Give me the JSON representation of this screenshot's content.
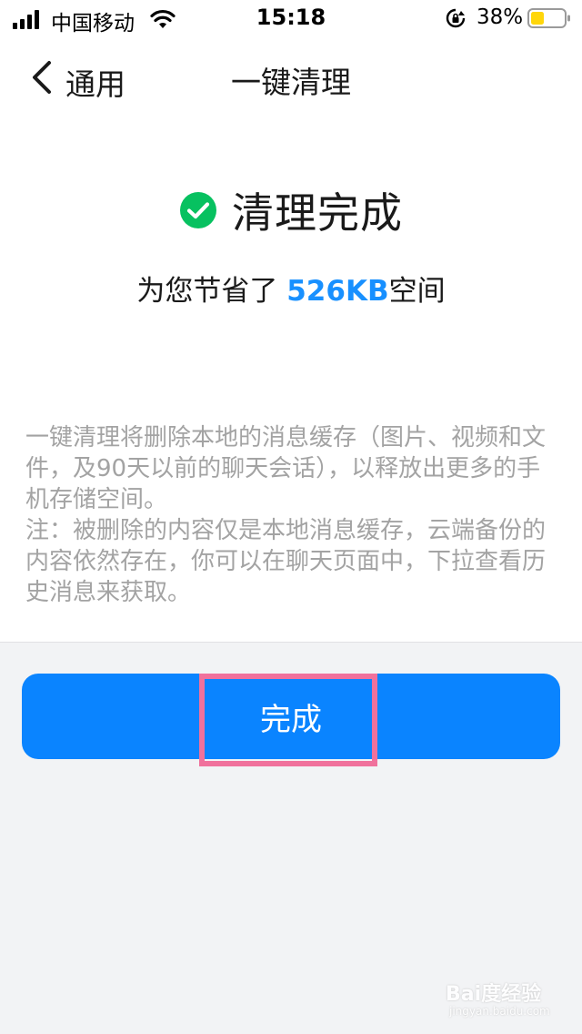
{
  "status_bar": {
    "carrier": "中国移动",
    "time": "15:18",
    "battery_percent": "38%",
    "icons": [
      "signal-icon",
      "wifi-icon",
      "orientation-lock-icon",
      "battery-icon"
    ]
  },
  "nav": {
    "back_label": "通用",
    "title": "一键清理"
  },
  "result": {
    "title": "清理完成",
    "saved_prefix": "为您节省了 ",
    "saved_size": "526KB",
    "saved_suffix": "空间",
    "icon": "check-circle-icon"
  },
  "description": {
    "line1": "一键清理将删除本地的消息缓存（图片、视频和文件，及90天以前的聊天会话），以释放出更多的手机存储空间。",
    "line2": "注：被删除的内容仅是本地消息缓存，云端备份的内容依然存在，你可以在聊天页面中，下拉查看历史消息来获取。"
  },
  "done_button": {
    "label": "完成"
  },
  "watermark": {
    "text": "Bai度经验",
    "sub": "jingyan.baidu.com"
  },
  "colors": {
    "accent": "#0a84ff",
    "success": "#07c160",
    "highlight": "#f0719c",
    "battery": "#ffd60a"
  }
}
